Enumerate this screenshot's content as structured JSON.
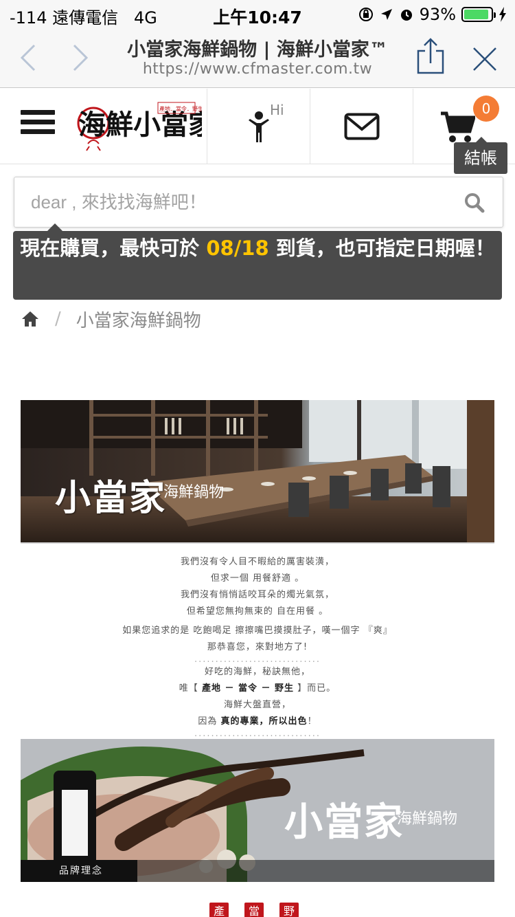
{
  "status_bar": {
    "carrier": "-114 遠傳電信",
    "network": "4G",
    "time": "上午10:47",
    "battery_percent": "93%",
    "battery_level": 0.93,
    "battery_color": "#4cd964"
  },
  "browser": {
    "page_title": "小當家海鮮鍋物 | 海鮮小當家™",
    "url": "https://www.cfmaster.com.tw",
    "icons": [
      "back-chevron-icon",
      "forward-chevron-icon",
      "share-icon",
      "close-icon"
    ]
  },
  "header": {
    "logo_text": "海鮮小當家",
    "logo_tagline": "產地．當令．野生",
    "hi_label": "Hi",
    "cart_count": "0",
    "checkout_label": "結帳",
    "accent_color": "#f47c35"
  },
  "search": {
    "placeholder": "dear , 來找找海鮮吧！",
    "value": ""
  },
  "notice": {
    "before": "現在購買，最快可於 ",
    "date": "08/18",
    "after": " 到貨，也可指定日期喔！",
    "date_color": "#ffc400"
  },
  "breadcrumb": {
    "separator": "/",
    "current": "小當家海鮮鍋物"
  },
  "hero": {
    "brand": "小當家",
    "sub": "海鮮鍋物"
  },
  "intro": {
    "lines": [
      "我們沒有令人目不暇給的厲害裝潢，",
      "但求一個 用餐舒適 。",
      "我們沒有悄悄話咬耳朵的燭光氣氛，",
      "但希望您無拘無束的 自在用餐 。",
      "如果您追求的是 吃飽喝足 擦擦嘴巴摸摸肚子，嘆一個字 『爽』",
      "那恭喜您，來對地方了!"
    ],
    "dots": "..............................",
    "lines2_a": "好吃的海鮮，秘訣無他，",
    "line_origin_pre": "唯【 ",
    "line_origin_bold": "產地 － 當令 － 野生",
    "line_origin_post": " 】而已。",
    "line_direct": "海鮮大盤直營，",
    "line_pro_pre": "因為 ",
    "line_pro_bold": "真的專業，所以出色",
    "line_pro_post": "！"
  },
  "brand_banner": {
    "brand": "小當家",
    "sub": "海鮮鍋物",
    "caption": "品牌理念"
  },
  "stamps": [
    "產",
    "當",
    "野"
  ]
}
